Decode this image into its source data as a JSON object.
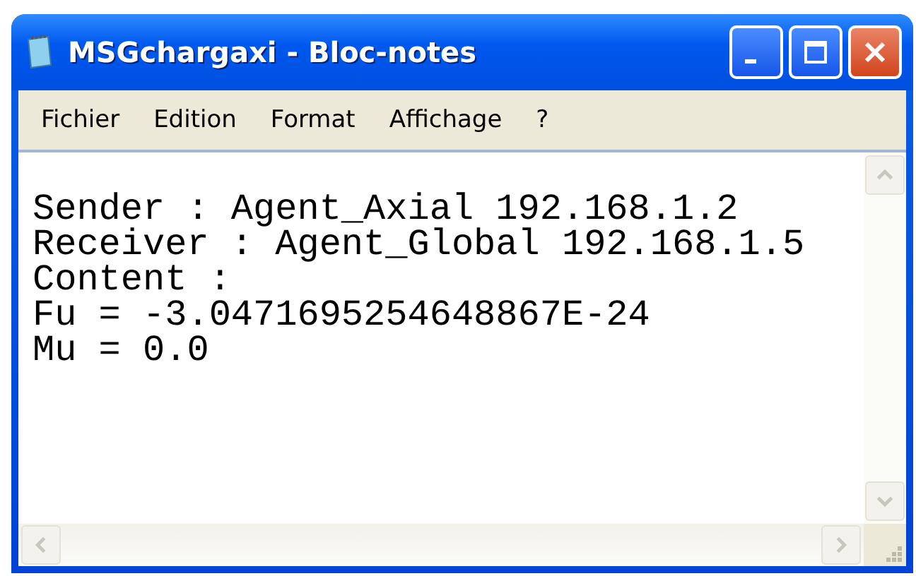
{
  "window": {
    "title": "MSGchargaxi - Bloc-notes"
  },
  "menu": [
    {
      "label": "Fichier"
    },
    {
      "label": "Edition"
    },
    {
      "label": "Format"
    },
    {
      "label": "Affichage"
    },
    {
      "label": "?"
    }
  ],
  "document": {
    "lines": [
      "Sender : Agent_Axial 192.168.1.2",
      "Receiver : Agent_Global 192.168.1.5",
      "Content :",
      "Fu = -3.0471695254648867E-24",
      "Mu = 0.0"
    ]
  }
}
